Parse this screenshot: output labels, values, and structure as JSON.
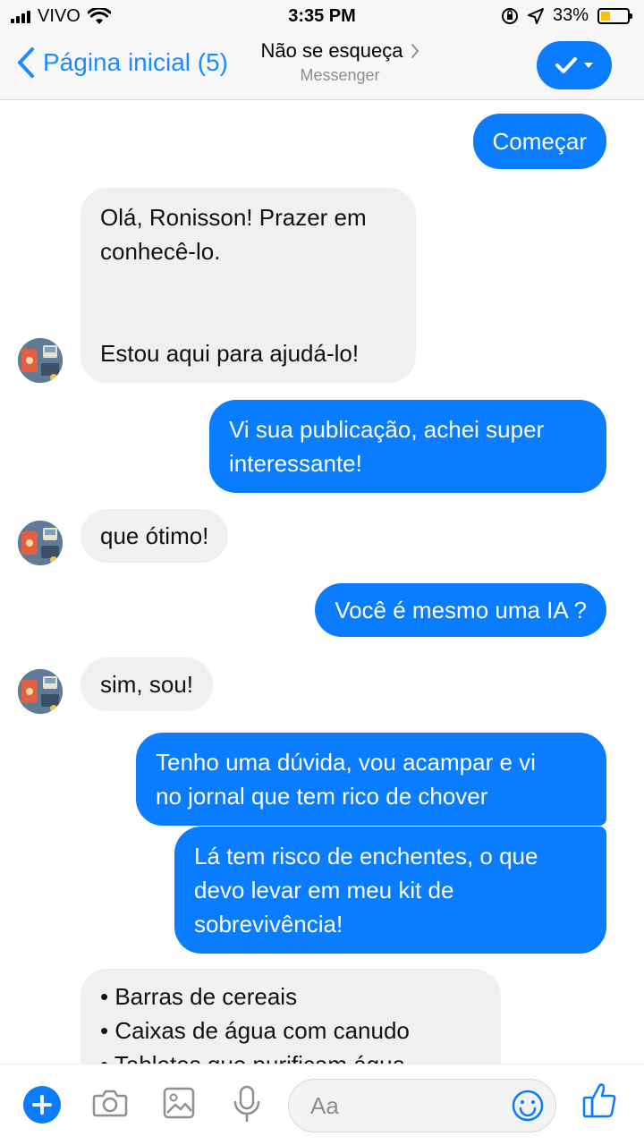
{
  "status_bar": {
    "carrier": "VIVO",
    "time": "3:35 PM",
    "battery_percent": "33%",
    "battery_level": 0.33
  },
  "nav": {
    "back_label": "Página inicial (5)",
    "title": "Não se esqueça",
    "subtitle": "Messenger",
    "accent_color": "#0a7cff"
  },
  "messages": [
    {
      "from": "me",
      "text": "Começar"
    },
    {
      "from": "bot",
      "lines": [
        "Olá, Ronisson! Prazer em",
        "conhecê-lo.",
        "",
        "",
        "Estou aqui para ajudá-lo!"
      ]
    },
    {
      "from": "me",
      "lines": [
        "Vi sua publicação, achei super",
        "interessante!"
      ]
    },
    {
      "from": "bot",
      "text": "que ótimo!"
    },
    {
      "from": "me",
      "text": "Você é mesmo uma IA ?"
    },
    {
      "from": "bot",
      "text": "sim, sou!"
    },
    {
      "from": "me",
      "lines": [
        "Tenho uma dúvida, vou acampar e vi",
        "no jornal que tem rico de chover"
      ]
    },
    {
      "from": "me",
      "lines": [
        "Lá tem risco de enchentes, o que",
        "devo levar em meu kit de",
        "sobrevivência!"
      ]
    },
    {
      "from": "bot",
      "lines": [
        "• Barras de cereais",
        "• Caixas de água com canudo",
        "• Tabletes que purificam água"
      ]
    }
  ],
  "composer": {
    "placeholder": "Aa",
    "icons": [
      "plus-icon",
      "camera-icon",
      "image-icon",
      "microphone-icon",
      "emoji-icon",
      "thumbs-up-icon"
    ]
  }
}
